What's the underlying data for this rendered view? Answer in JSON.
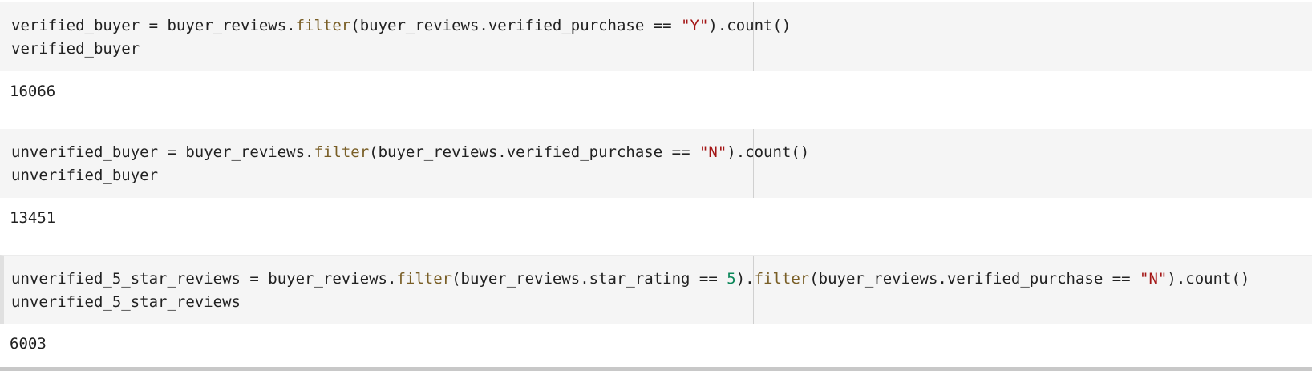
{
  "cells": [
    {
      "input": {
        "line1": {
          "a": "verified_buyer = buyer_reviews.",
          "m1": "filter",
          "b": "(buyer_reviews.verified_purchase == ",
          "s1": "\"Y\"",
          "c": ").count()"
        },
        "line2": "verified_buyer"
      },
      "output": "16066"
    },
    {
      "input": {
        "line1": {
          "a": "unverified_buyer = buyer_reviews.",
          "m1": "filter",
          "b": "(buyer_reviews.verified_purchase == ",
          "s1": "\"N\"",
          "c": ").count()"
        },
        "line2": "unverified_buyer"
      },
      "output": "13451"
    },
    {
      "input": {
        "line1": {
          "a": "unverified_5_star_reviews = buyer_reviews.",
          "m1": "filter",
          "b": "(buyer_reviews.star_rating == ",
          "n1": "5",
          "c": ").",
          "m2": "filter",
          "d": "(buyer_reviews.verified_purchase == ",
          "s1": "\"N\"",
          "e": ").count()"
        },
        "line2": "unverified_5_star_reviews"
      },
      "output": "6003"
    }
  ]
}
